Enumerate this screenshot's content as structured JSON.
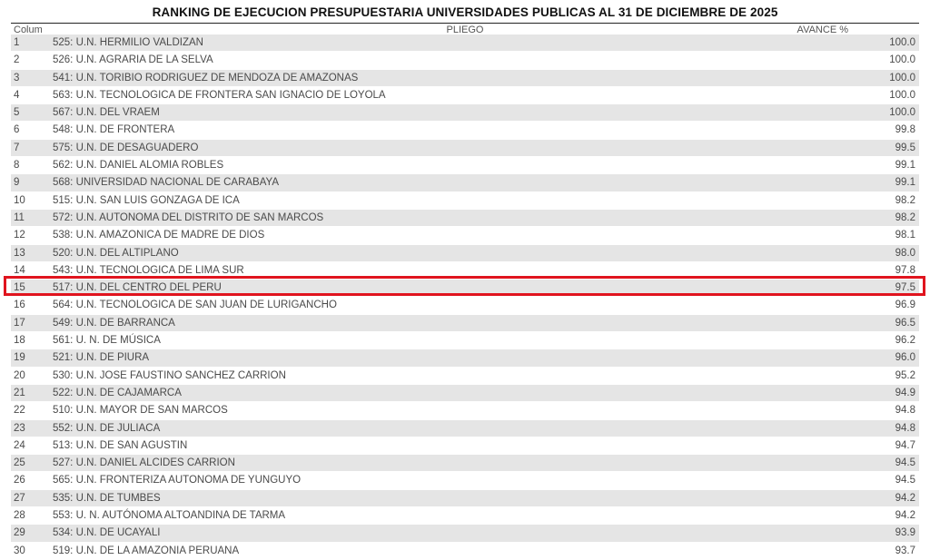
{
  "title": "RANKING DE EJECUCION PRESUPUESTARIA UNIVERSIDADES PUBLICAS AL 31 DE DICIEMBRE DE 2025",
  "columns": {
    "num": "Colum",
    "pliego": "PLIEGO",
    "avance": "AVANCE %"
  },
  "highlight_color": "#e0141e",
  "rows": [
    {
      "num": "1",
      "pliego": "525: U.N. HERMILIO VALDIZAN",
      "avance": "100.0"
    },
    {
      "num": "2",
      "pliego": "526: U.N. AGRARIA DE LA SELVA",
      "avance": "100.0"
    },
    {
      "num": "3",
      "pliego": "541: U.N. TORIBIO RODRIGUEZ DE MENDOZA DE AMAZONAS",
      "avance": "100.0"
    },
    {
      "num": "4",
      "pliego": "563: U.N. TECNOLOGICA DE FRONTERA SAN IGNACIO DE LOYOLA",
      "avance": "100.0"
    },
    {
      "num": "5",
      "pliego": "567: U.N. DEL VRAEM",
      "avance": "100.0"
    },
    {
      "num": "6",
      "pliego": "548: U.N. DE FRONTERA",
      "avance": "99.8"
    },
    {
      "num": "7",
      "pliego": "575: U.N. DE DESAGUADERO",
      "avance": "99.5"
    },
    {
      "num": "8",
      "pliego": "562: U.N. DANIEL ALOMIA ROBLES",
      "avance": "99.1"
    },
    {
      "num": "9",
      "pliego": "568: UNIVERSIDAD NACIONAL DE CARABAYA",
      "avance": "99.1"
    },
    {
      "num": "10",
      "pliego": "515: U.N. SAN LUIS GONZAGA DE ICA",
      "avance": "98.2"
    },
    {
      "num": "11",
      "pliego": "572: U.N. AUTONOMA DEL DISTRITO DE SAN MARCOS",
      "avance": "98.2"
    },
    {
      "num": "12",
      "pliego": "538: U.N. AMAZONICA DE MADRE DE DIOS",
      "avance": "98.1"
    },
    {
      "num": "13",
      "pliego": "520: U.N. DEL ALTIPLANO",
      "avance": "98.0"
    },
    {
      "num": "14",
      "pliego": "543: U.N. TECNOLOGICA DE LIMA SUR",
      "avance": "97.8"
    },
    {
      "num": "15",
      "pliego": "517: U.N. DEL CENTRO DEL PERU",
      "avance": "97.5"
    },
    {
      "num": "16",
      "pliego": "564: U.N. TECNOLOGICA DE SAN JUAN DE LURIGANCHO",
      "avance": "96.9"
    },
    {
      "num": "17",
      "pliego": "549: U.N. DE BARRANCA",
      "avance": "96.5"
    },
    {
      "num": "18",
      "pliego": "561: U. N. DE MÚSICA",
      "avance": "96.2"
    },
    {
      "num": "19",
      "pliego": "521: U.N. DE PIURA",
      "avance": "96.0"
    },
    {
      "num": "20",
      "pliego": "530: U.N. JOSE FAUSTINO SANCHEZ CARRION",
      "avance": "95.2"
    },
    {
      "num": "21",
      "pliego": "522: U.N. DE CAJAMARCA",
      "avance": "94.9"
    },
    {
      "num": "22",
      "pliego": "510: U.N. MAYOR DE SAN MARCOS",
      "avance": "94.8"
    },
    {
      "num": "23",
      "pliego": "552: U.N. DE JULIACA",
      "avance": "94.8"
    },
    {
      "num": "24",
      "pliego": "513: U.N. DE SAN AGUSTIN",
      "avance": "94.7"
    },
    {
      "num": "25",
      "pliego": "527: U.N. DANIEL ALCIDES CARRION",
      "avance": "94.5"
    },
    {
      "num": "26",
      "pliego": "565: U.N. FRONTERIZA AUTONOMA DE YUNGUYO",
      "avance": "94.5"
    },
    {
      "num": "27",
      "pliego": "535: U.N. DE TUMBES",
      "avance": "94.2"
    },
    {
      "num": "28",
      "pliego": "553: U. N. AUTÓNOMA ALTOANDINA DE TARMA",
      "avance": "94.2"
    },
    {
      "num": "29",
      "pliego": "534: U.N. DE UCAYALI",
      "avance": "93.9"
    },
    {
      "num": "30",
      "pliego": "519: U.N. DE LA AMAZONIA PERUANA",
      "avance": "93.7"
    }
  ]
}
